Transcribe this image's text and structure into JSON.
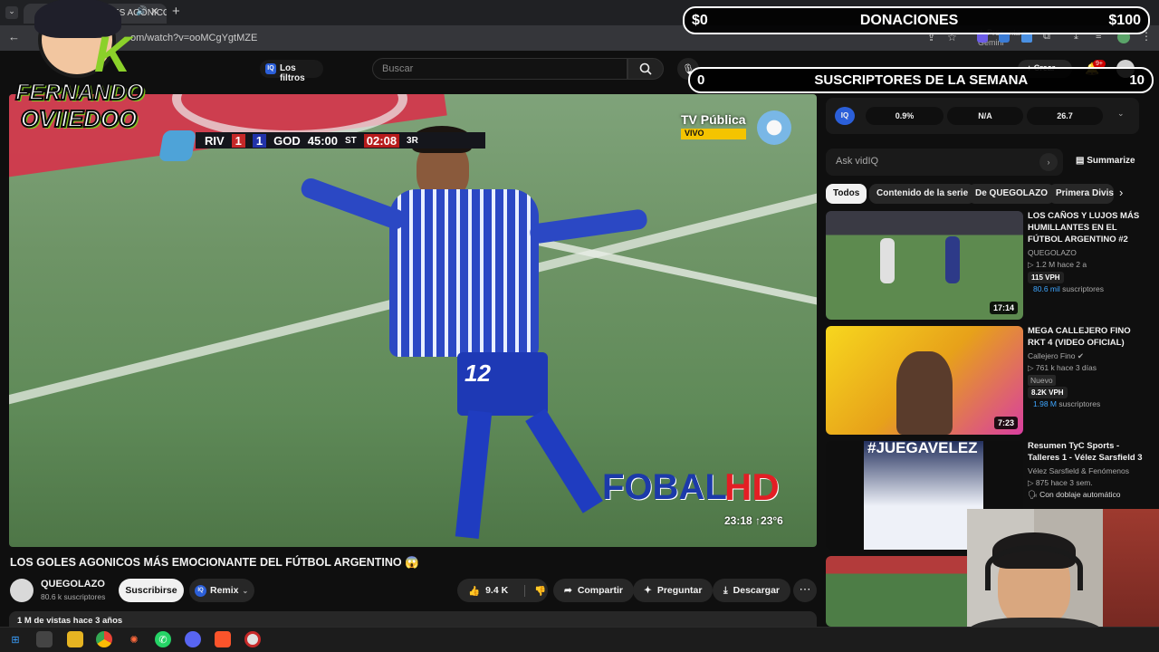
{
  "browser": {
    "tab_title": "(1) LOS GOLES AGONICOS M",
    "url": "om/watch?v=ooMCgYgtMZE",
    "gemini_label": "Pregunta a Gemini"
  },
  "overlay": {
    "channel_logo_top": "FERNANDO",
    "channel_logo_bottom": "OVIIEDOO",
    "donations": {
      "left": "$0",
      "label": "DONACIONES",
      "right": "$100"
    },
    "subs": {
      "left": "0",
      "label": "SUSCRIPTORES DE LA SEMANA",
      "right": "10"
    }
  },
  "youtube": {
    "filters_label": "Los filtros",
    "search_placeholder": "Buscar",
    "create_label": "Crear",
    "notification_count": "9+"
  },
  "video": {
    "scorebug": {
      "team1": "RIV",
      "score1": "1",
      "score2": "1",
      "team2": "GOD",
      "clock": "45:00",
      "half": "ST",
      "extra": "02:08",
      "tag": "3R"
    },
    "broadcaster": "TV Pública",
    "live_label": "VIVO",
    "watermark_a": "FOBAL",
    "watermark_b": "HD",
    "corner_time": "23:18 ↑23°6",
    "jersey_number": "12",
    "title": "LOS GOLES AGONICOS MÁS EMOCIONANTE DEL FÚTBOL ARGENTINO 😱",
    "channel": "QUEGOLAZO",
    "subscribers": "80.6 k suscriptores",
    "subscribe_label": "Suscribirse",
    "remix_label": "Remix",
    "likes": "9.4 K",
    "share_label": "Compartir",
    "ask_label": "Preguntar",
    "download_label": "Descargar",
    "views_line": "1 M de vistas  hace 3 años"
  },
  "vidiq": {
    "logo": "IQ",
    "stat1": "0.9%",
    "stat2": "N/A",
    "stat3": "26.7",
    "ask_placeholder": "Ask vidIQ",
    "summarize_label": "Summarize"
  },
  "chips": [
    "Todos",
    "Contenido de la serie",
    "De QUEGOLAZO",
    "Primera Divisi"
  ],
  "recommended": [
    {
      "title": "LOS CAÑOS Y LUJOS MÁS HUMILLANTES EN EL FÚTBOL ARGENTINO #2",
      "channel": "QUEGOLAZO",
      "stats": "▷ 1.2 M   hace 2 a",
      "vph": "115 VPH",
      "subs_count": "80.6 mil",
      "subs_word": "suscriptores",
      "duration": "17:14",
      "extra": ""
    },
    {
      "title": "MEGA CALLEJERO FINO RKT 4 (VIDEO OFICIAL)",
      "channel": "Callejero Fino",
      "stats": "▷ 761 k   hace 3 días",
      "vph": "8.2K VPH",
      "subs_count": "1.98 M",
      "subs_word": "suscriptores",
      "duration": "7:23",
      "extra": "Nuevo"
    },
    {
      "title": "Resumen TyC Sports - Talleres 1 - Vélez Sarsfield 3",
      "channel": "Vélez Sarsfield & Fenómenos",
      "stats": "▷ 875   hace 3 sem.",
      "vph": "",
      "subs_count": "",
      "subs_word": "",
      "duration": "",
      "extra": "Con doblaje automático"
    }
  ],
  "thumb_texts": {
    "jueg": "#JUEGAVELEZ"
  }
}
